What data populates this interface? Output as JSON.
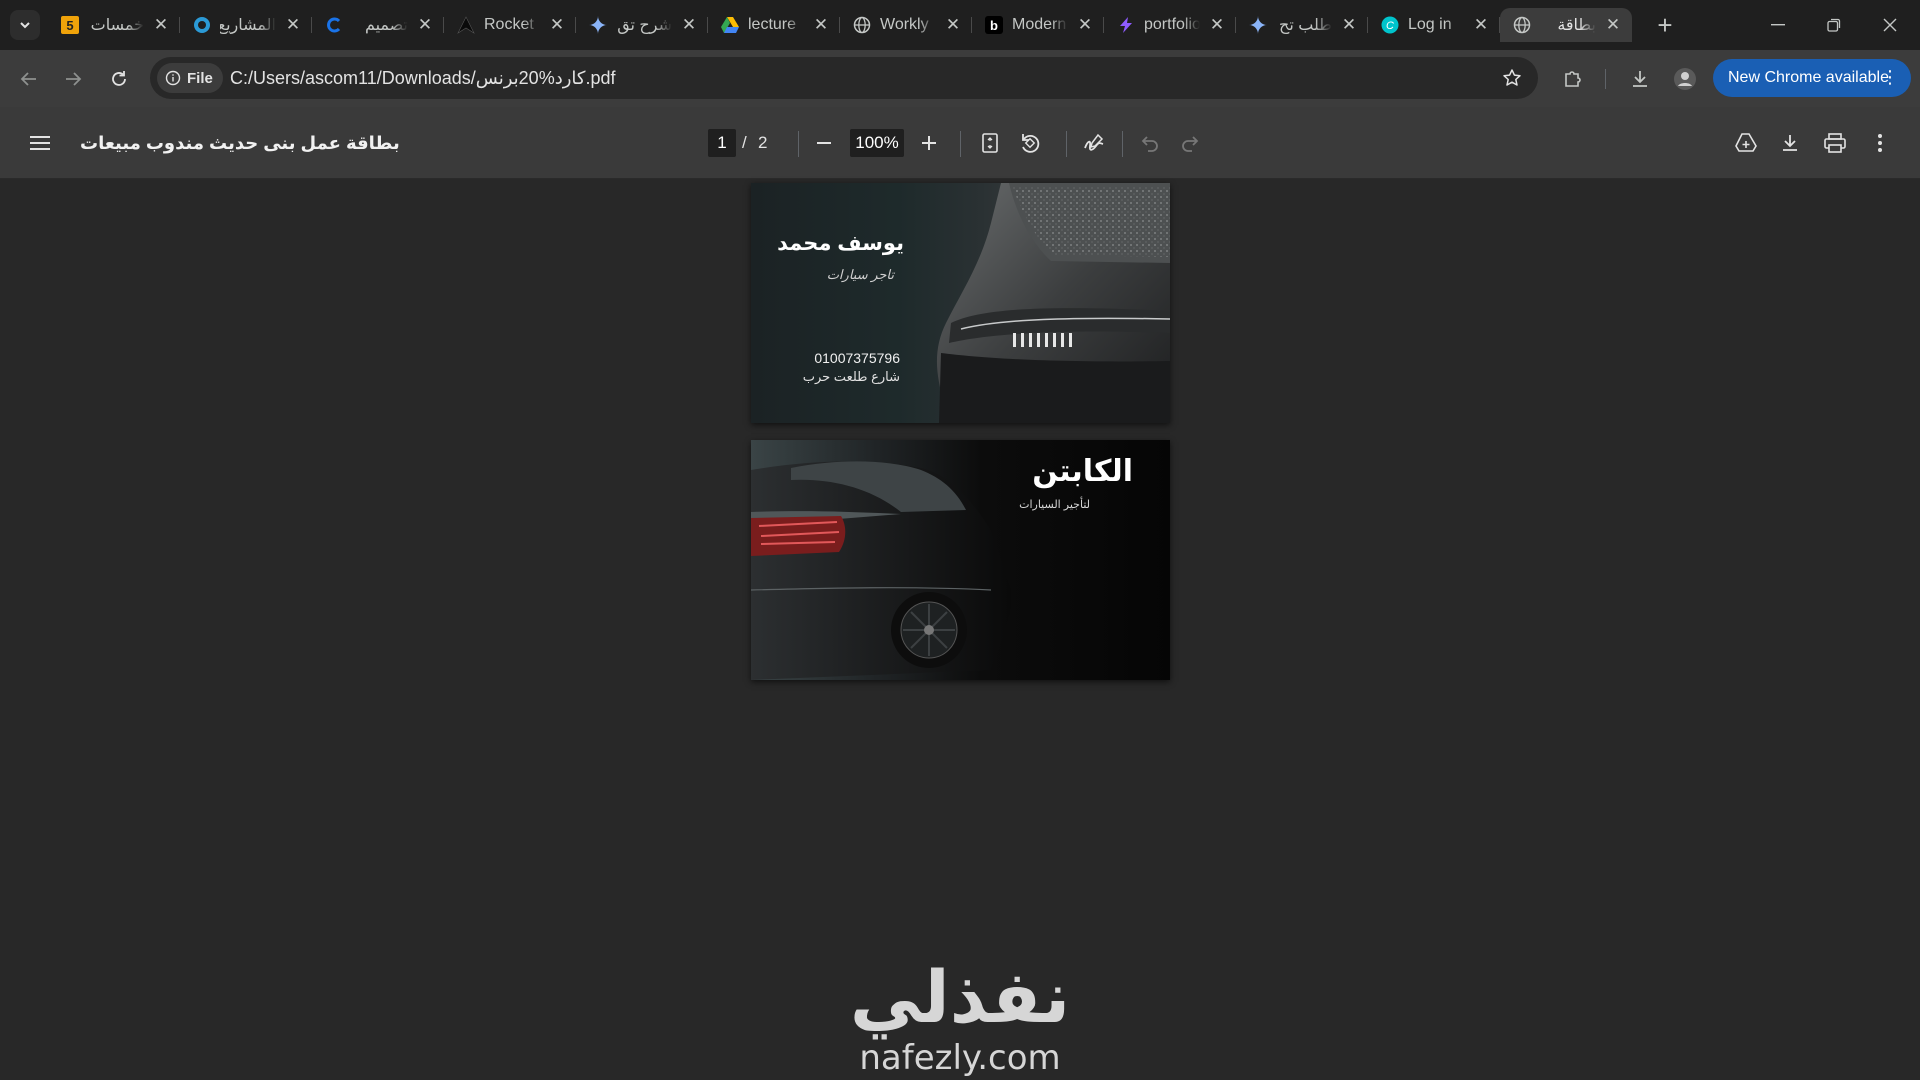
{
  "browser": {
    "tabs": [
      {
        "title": "خمسات",
        "icon": "khamsat-icon",
        "color": "#f0a30a",
        "active": false
      },
      {
        "title": "المشاريع",
        "icon": "mostaql-icon",
        "color": "#2b9ad6",
        "active": false
      },
      {
        "title": "تصميم",
        "icon": "canva-edit-icon",
        "color": "#1a73e8",
        "active": false
      },
      {
        "title": "Rocket",
        "icon": "rocket-icon",
        "color": "#111111",
        "active": false
      },
      {
        "title": "شرح تق",
        "icon": "gemini-icon",
        "color": "#8ab4f8",
        "active": false
      },
      {
        "title": "lecture",
        "icon": "google-drive-icon",
        "color": "#34a853",
        "active": false
      },
      {
        "title": "Workly",
        "icon": "globe-icon",
        "color": "#c4c7c5",
        "active": false
      },
      {
        "title": "Modern",
        "icon": "behance-icon",
        "color": "#000000",
        "active": false
      },
      {
        "title": "portfolio",
        "icon": "lightning-icon",
        "color": "#8e5bff",
        "active": false
      },
      {
        "title": "طلب تح",
        "icon": "gemini-icon",
        "color": "#8ab4f8",
        "active": false
      },
      {
        "title": "Log in",
        "icon": "canva-icon",
        "color": "#00c4cc",
        "active": false
      },
      {
        "title": "بطاقة",
        "icon": "globe-icon",
        "color": "#c4c7c5",
        "active": true
      }
    ],
    "address": {
      "chip_label": "File",
      "url": "C:/Users/ascom11/Downloads/كارد%20برنس.pdf"
    },
    "update_button": "New Chrome available"
  },
  "pdf": {
    "title": "بطاقة عمل بنى حديث مندوب مبيعات",
    "current_page": "1",
    "page_separator": "/",
    "total_pages": "2",
    "zoom": "100%"
  },
  "card_front": {
    "name": "يوسف محمد",
    "role": "تاجر سيارات",
    "phone": "01007375796",
    "address": "شارع طلعت حرب"
  },
  "card_back": {
    "brand": "الكابتن",
    "tagline": "لتأجير السيارات"
  },
  "watermark": {
    "arabic": "نفذلي",
    "latin": "nafezly.com"
  }
}
